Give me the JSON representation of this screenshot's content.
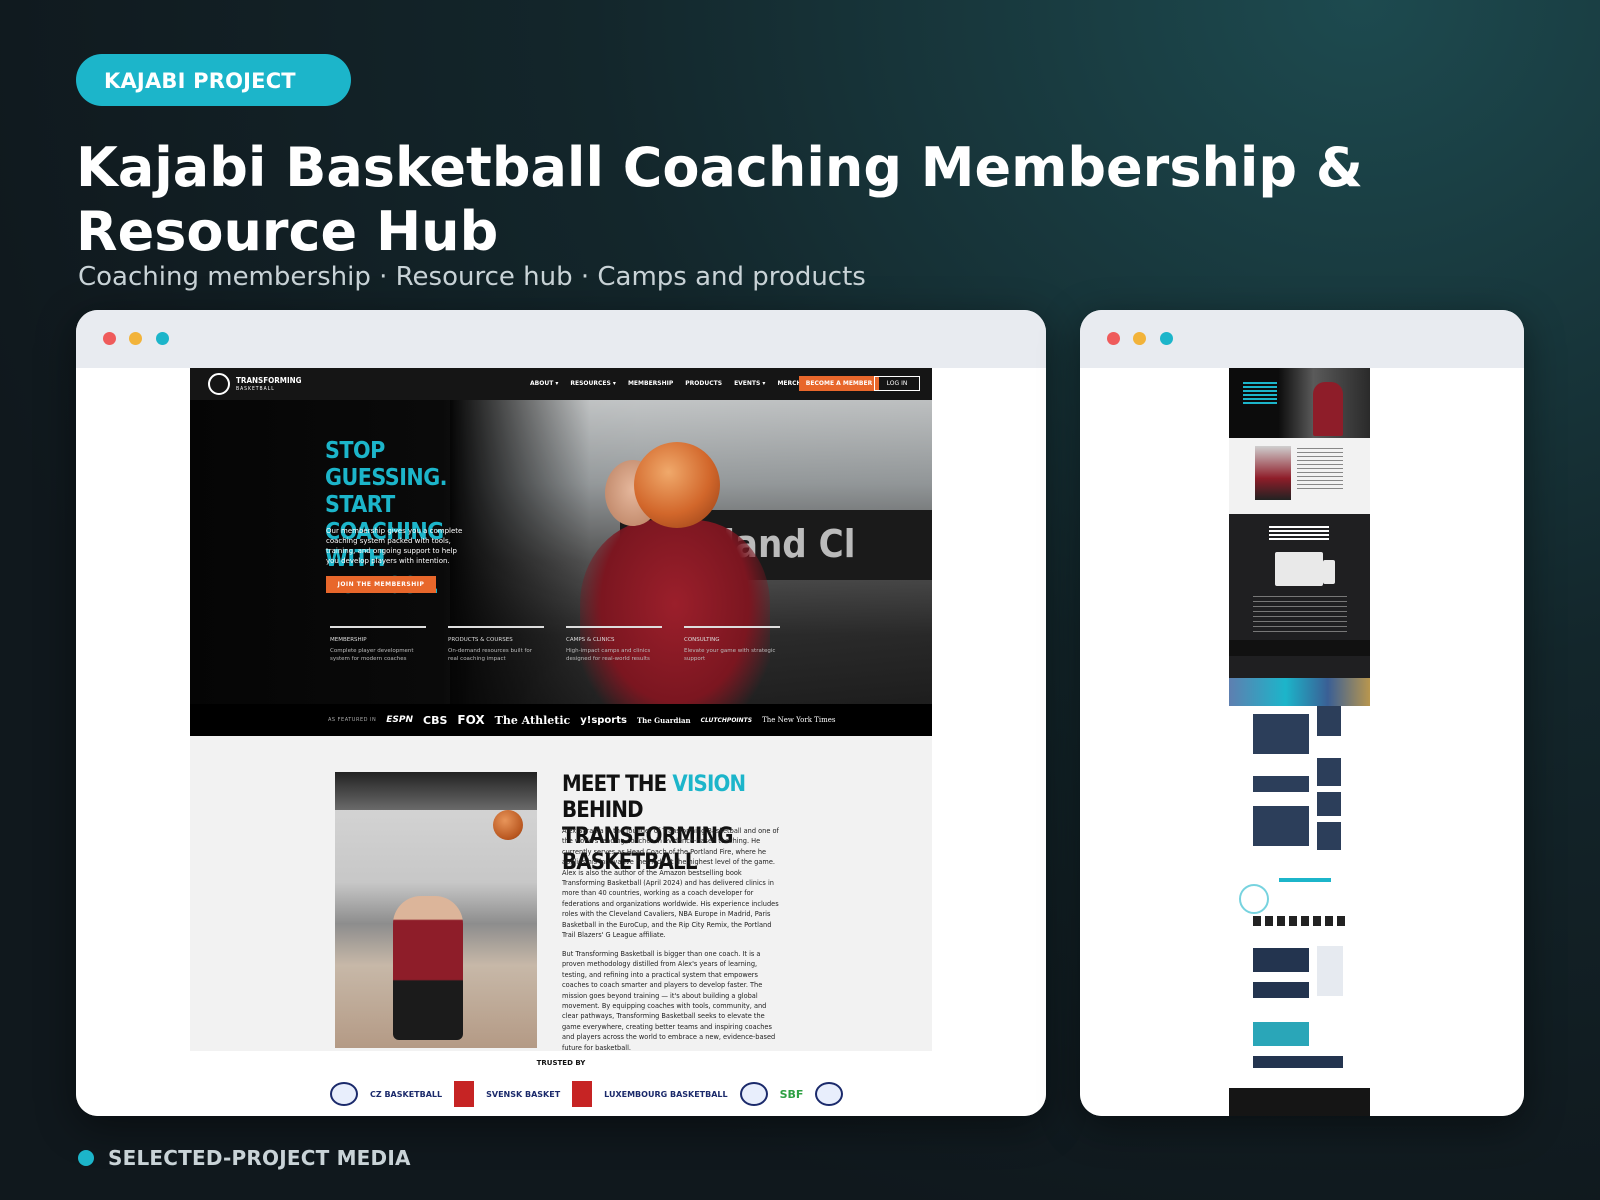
{
  "header": {
    "tag": "KAJABI PROJECT",
    "title": "Kajabi Basketball Coaching Membership & Resource Hub",
    "subtitle": "Coaching membership · Resource hub · Camps and products"
  },
  "site": {
    "logo_main": "TRANSFORMING",
    "logo_sub": "BASKETBALL",
    "nav": [
      "ABOUT ▾",
      "RESOURCES ▾",
      "MEMBERSHIP",
      "PRODUCTS",
      "EVENTS ▾",
      "MERCH"
    ],
    "become_member": "BECOME A MEMBER",
    "login": "LOG IN",
    "hero": {
      "headline": "STOP GUESSING. START COACHING WITH PURPOSE.",
      "body": "Our membership gives you a complete coaching system packed with tools, training, and ongoing support to help you develop players with intention.",
      "cta": "JOIN THE MEMBERSHIP",
      "banner_text": "eland Cl",
      "cards": [
        {
          "title": "MEMBERSHIP",
          "text": "Complete player development system for modern coaches"
        },
        {
          "title": "PRODUCTS & COURSES",
          "text": "On-demand resources built for real coaching impact"
        },
        {
          "title": "CAMPS & CLINICS",
          "text": "High-impact camps and clinics designed for real-world results"
        },
        {
          "title": "CONSULTING",
          "text": "Elevate your game with strategic support"
        }
      ]
    },
    "featured": {
      "label": "AS FEATURED IN",
      "logos": [
        "ESPN",
        "CBS",
        "FOX",
        "The Athletic",
        "y!sports",
        "The Guardian",
        "CLUTCHPOINTS",
        "The New York Times"
      ]
    },
    "vision": {
      "heading_pre": "MEET THE ",
      "heading_accent": "VISION",
      "heading_post": " BEHIND TRANSFORMING BASKETBALL",
      "p1": "Alex Sarama is the founder of Transforming Basketball and one of the world's leading coaches in evidence-based teaching. He currently serves as Head Coach of the Portland Fire, where he applies his innovative methods at the highest level of the game. Alex is also the author of the Amazon bestselling book Transforming Basketball (April 2024) and has delivered clinics in more than 40 countries, working as a coach developer for federations and organizations worldwide. His experience includes roles with the Cleveland Cavaliers, NBA Europe in Madrid, Paris Basketball in the EuroCup, and the Rip City Remix, the Portland Trail Blazers' G League affiliate.",
      "p2": "But Transforming Basketball is bigger than one coach. It is a proven methodology distilled from Alex's years of learning, testing, and refining into a practical system that empowers coaches to coach smarter and players to develop faster. The mission goes beyond training — it's about building a global movement. By equipping coaches with tools, community, and clear pathways, Transforming Basketball seeks to elevate the game everywhere, creating better teams and inspiring coaches and players across the world to embrace a new, evidence-based future for basketball."
    },
    "trusted": {
      "label": "TRUSTED BY",
      "logos": [
        "CZ BASKETBALL",
        "SVENSK BASKET",
        "LUXEMBOURG BASKETBALL",
        "SBF"
      ]
    }
  },
  "footer": {
    "label": "SELECTED-PROJECT MEDIA"
  },
  "colors": {
    "accent": "#1cb5ca",
    "orange": "#e8672b",
    "background": "#13262b"
  }
}
